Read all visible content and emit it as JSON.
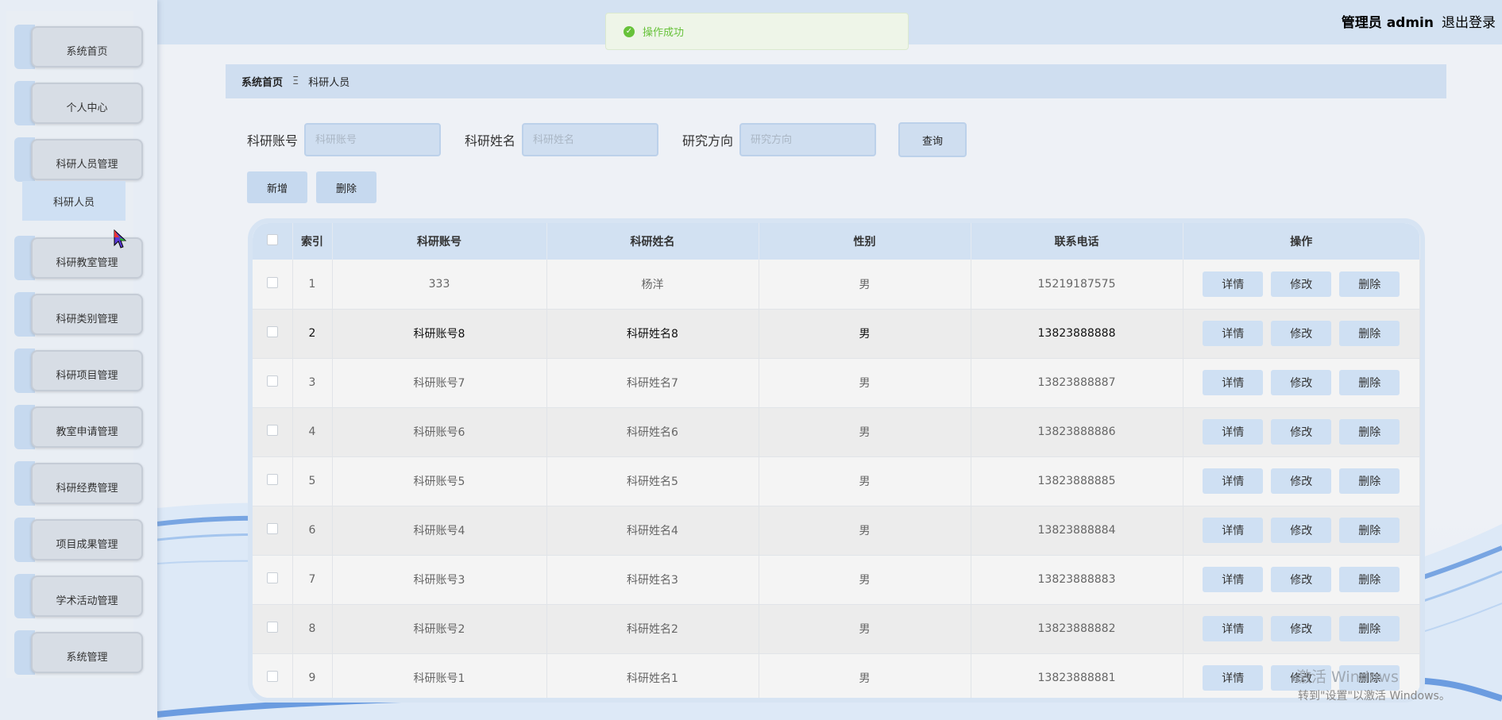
{
  "header": {
    "toast": "操作成功",
    "user_role": "管理员",
    "user_name": "admin",
    "logout": "退出登录"
  },
  "sidebar": {
    "items": [
      {
        "label": "系统首页"
      },
      {
        "label": "个人中心"
      },
      {
        "label": "科研人员管理"
      },
      {
        "label": "科研教室管理"
      },
      {
        "label": "科研类别管理"
      },
      {
        "label": "科研项目管理"
      },
      {
        "label": "教室申请管理"
      },
      {
        "label": "科研经费管理"
      },
      {
        "label": "项目成果管理"
      },
      {
        "label": "学术活动管理"
      },
      {
        "label": "系统管理"
      }
    ],
    "submenu": "科研人员"
  },
  "breadcrumb": {
    "home": "系统首页",
    "separator": "Ξ",
    "current": "科研人员"
  },
  "search": {
    "account_label": "科研账号",
    "account_placeholder": "科研账号",
    "name_label": "科研姓名",
    "name_placeholder": "科研姓名",
    "direction_label": "研究方向",
    "direction_placeholder": "研究方向",
    "query": "查询"
  },
  "actions": {
    "add": "新增",
    "delete": "删除"
  },
  "table": {
    "headers": [
      "索引",
      "科研账号",
      "科研姓名",
      "性别",
      "联系电话",
      "操作"
    ],
    "op_labels": {
      "detail": "详情",
      "edit": "修改",
      "delete": "删除"
    },
    "rows": [
      {
        "index": "1",
        "account": "333",
        "name": "杨洋",
        "gender": "男",
        "phone": "15219187575"
      },
      {
        "index": "2",
        "account": "科研账号8",
        "name": "科研姓名8",
        "gender": "男",
        "phone": "13823888888"
      },
      {
        "index": "3",
        "account": "科研账号7",
        "name": "科研姓名7",
        "gender": "男",
        "phone": "13823888887"
      },
      {
        "index": "4",
        "account": "科研账号6",
        "name": "科研姓名6",
        "gender": "男",
        "phone": "13823888886"
      },
      {
        "index": "5",
        "account": "科研账号5",
        "name": "科研姓名5",
        "gender": "男",
        "phone": "13823888885"
      },
      {
        "index": "6",
        "account": "科研账号4",
        "name": "科研姓名4",
        "gender": "男",
        "phone": "13823888884"
      },
      {
        "index": "7",
        "account": "科研账号3",
        "name": "科研姓名3",
        "gender": "男",
        "phone": "13823888883"
      },
      {
        "index": "8",
        "account": "科研账号2",
        "name": "科研姓名2",
        "gender": "男",
        "phone": "13823888882"
      },
      {
        "index": "9",
        "account": "科研账号1",
        "name": "科研姓名1",
        "gender": "男",
        "phone": "13823888881"
      }
    ]
  },
  "watermark": {
    "line1": "激活 Windows",
    "line2": "转到\"设置\"以激活 Windows。"
  },
  "colors": {
    "accent": "#cfdef0",
    "sidebar_bg": "#e7edf5",
    "success": "#67c23a"
  }
}
